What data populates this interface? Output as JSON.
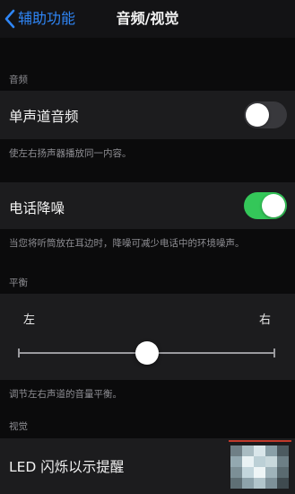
{
  "nav": {
    "back_label": "辅助功能",
    "title": "音频/视觉"
  },
  "audio_section": {
    "header": "音频",
    "mono_audio": {
      "label": "单声道音频",
      "enabled": false,
      "note": "使左右扬声器播放同一内容。"
    },
    "phone_noise_cancellation": {
      "label": "电话降噪",
      "enabled": true,
      "note": "当您将听筒放在耳边时，降噪可减少电话中的环境噪声。"
    }
  },
  "balance_section": {
    "header": "平衡",
    "left_label": "左",
    "right_label": "右",
    "balance_position": 0.5,
    "note": "调节左右声道的音量平衡。"
  },
  "visual_section": {
    "header": "视觉",
    "led_flash": {
      "label": "LED 闪烁以示提醒"
    }
  },
  "colors": {
    "accent_blue": "#2f86f6",
    "toggle_on": "#34c759",
    "toggle_off": "#38383c",
    "cell_bg": "#1c1c1e",
    "page_bg": "#0b0b0c"
  }
}
